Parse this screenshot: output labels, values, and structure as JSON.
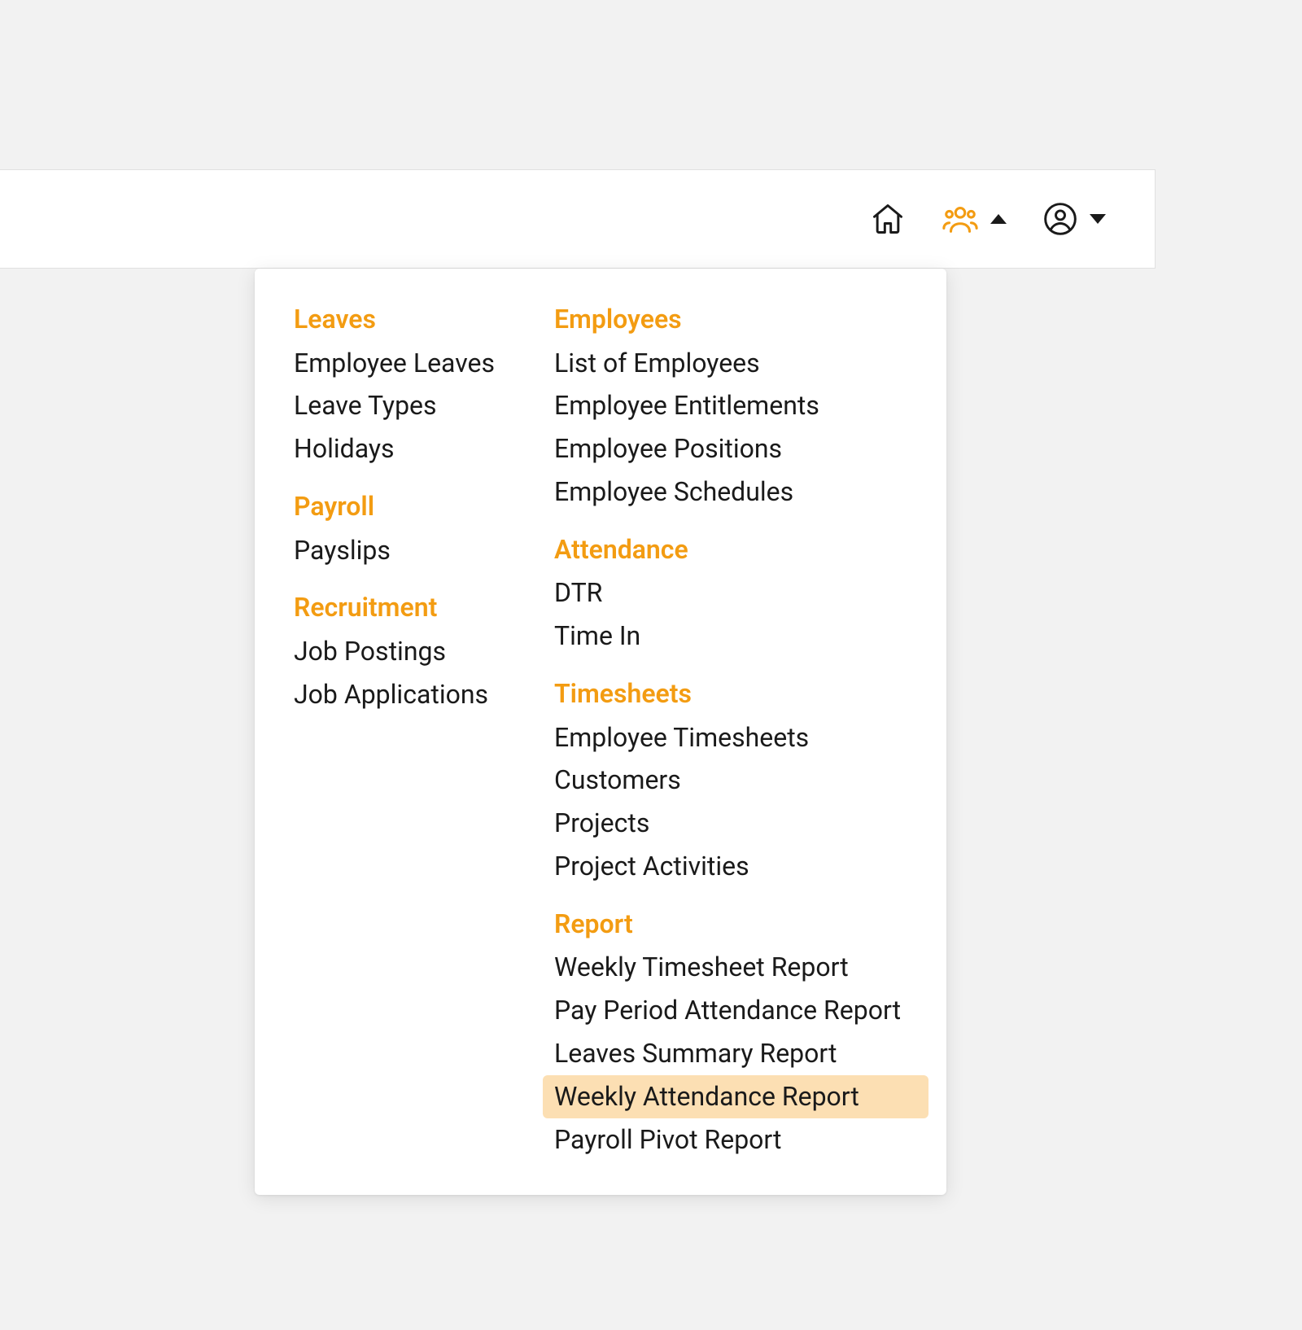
{
  "menu": {
    "leftColumn": [
      {
        "title": "Leaves",
        "items": [
          "Employee Leaves",
          "Leave Types",
          "Holidays"
        ]
      },
      {
        "title": "Payroll",
        "items": [
          "Payslips"
        ]
      },
      {
        "title": "Recruitment",
        "items": [
          "Job Postings",
          "Job Applications"
        ]
      }
    ],
    "rightColumn": [
      {
        "title": "Employees",
        "items": [
          "List of Employees",
          "Employee Entitlements",
          "Employee Positions",
          "Employee Schedules"
        ]
      },
      {
        "title": "Attendance",
        "items": [
          "DTR",
          "Time In"
        ]
      },
      {
        "title": "Timesheets",
        "items": [
          "Employee Timesheets",
          "Customers",
          "Projects",
          "Project Activities"
        ]
      },
      {
        "title": "Report",
        "items": [
          "Weekly Timesheet Report",
          "Pay Period Attendance Report",
          "Leaves Summary Report",
          "Weekly Attendance Report",
          "Payroll Pivot Report"
        ]
      }
    ],
    "highlighted": "Weekly Attendance Report"
  }
}
